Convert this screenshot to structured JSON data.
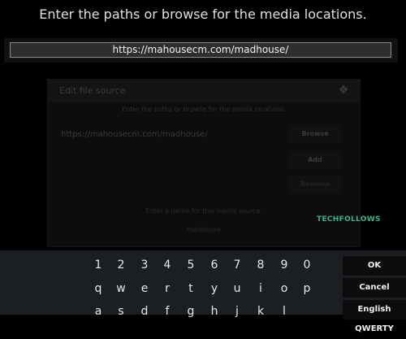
{
  "dialog_bg": {
    "title": "Edit file source",
    "prompt": "Enter the paths or browse for the media locations.",
    "path": "https://mahousecm.com/madhouse/",
    "browse": "Browse",
    "add": "Add",
    "remove": "Remove",
    "hint": "Enter a name for this media source.",
    "name": "madhouse"
  },
  "watermark": "TECHFOLLOWS",
  "input": {
    "heading": "Enter the paths or browse for the media locations.",
    "value": "https://mahousecm.com/madhouse/"
  },
  "keyboard": {
    "row1": [
      "1",
      "2",
      "3",
      "4",
      "5",
      "6",
      "7",
      "8",
      "9",
      "0"
    ],
    "row2": [
      "q",
      "w",
      "e",
      "r",
      "t",
      "y",
      "u",
      "i",
      "o",
      "p"
    ],
    "row3": [
      "a",
      "s",
      "d",
      "f",
      "g",
      "h",
      "j",
      "k",
      "l"
    ],
    "ok": "OK",
    "cancel": "Cancel",
    "layout": "English QWERTY"
  }
}
